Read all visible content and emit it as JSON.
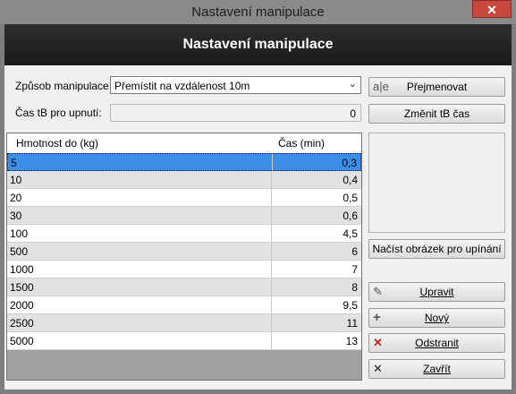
{
  "window": {
    "title": "Nastavení manipulace",
    "close_glyph": "✕"
  },
  "header": {
    "title": "Nastavení manipulace"
  },
  "form": {
    "method_label": "Způsob manipulace:",
    "method_value": "Přemístit na vzdálenost 10m",
    "time_label": "Čas tB pro upnutí:",
    "time_value": "0"
  },
  "buttons": {
    "rename": {
      "label": "Přejmenovat",
      "icon": "rename-icon"
    },
    "change_time": {
      "label": "Změnit tB čas"
    },
    "load_image": {
      "label": "Načíst obrázek pro upínání"
    },
    "edit": {
      "label": "Upravit",
      "icon": "pencil-icon"
    },
    "new": {
      "label": "Nový",
      "icon": "plus-icon"
    },
    "delete": {
      "label": "Odstranit",
      "icon": "red-x-icon"
    },
    "close": {
      "label": "Zavřít",
      "icon": "x-icon"
    }
  },
  "table": {
    "columns": [
      "Hmotnost do (kg)",
      "Čas (min)"
    ],
    "rows": [
      [
        "5",
        "0,3"
      ],
      [
        "10",
        "0,4"
      ],
      [
        "20",
        "0,5"
      ],
      [
        "30",
        "0,6"
      ],
      [
        "100",
        "4,5"
      ],
      [
        "500",
        "6"
      ],
      [
        "1000",
        "7"
      ],
      [
        "1500",
        "8"
      ],
      [
        "2000",
        "9,5"
      ],
      [
        "2500",
        "11"
      ],
      [
        "5000",
        "13"
      ]
    ],
    "selected_index": 0
  },
  "colors": {
    "selection": "#3d8ee8",
    "header_bg": "#222222",
    "close_red": "#c7483d"
  }
}
